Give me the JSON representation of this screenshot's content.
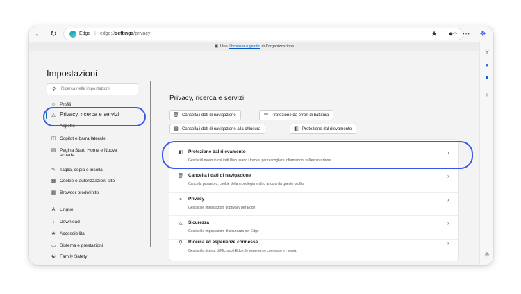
{
  "toolbar": {
    "back_icon": "arrow-left-icon",
    "refresh_icon": "refresh-icon",
    "site_label": "Edge",
    "url_prefix": "edge://",
    "url_bold": "settings",
    "url_suffix": "/privacy"
  },
  "banner": {
    "prefix": "Il tuo ",
    "link": "il browser è gestito",
    "suffix": " dall'organizzazione"
  },
  "nav": {
    "title": "Impostazioni",
    "search_placeholder": "Ricerca nelle impostazioni",
    "items": [
      {
        "label": "Profili",
        "icon": "profile-icon"
      },
      {
        "label": "Privacy, ricerca e servizi",
        "icon": "lock-icon"
      },
      {
        "label": "Aspetto",
        "icon": "appearance-icon"
      },
      {
        "label": "Copilot e barra laterale",
        "icon": "sidebar-icon"
      },
      {
        "label": "Pagina Start, Home e Nuova",
        "label2": "scheda",
        "icon": "home-icon"
      },
      {
        "label": "Taglia, copia e incolla",
        "icon": "clipboard-icon"
      },
      {
        "label": "Cookie e autorizzazioni sito",
        "icon": "cookie-icon"
      },
      {
        "label": "Browser predefinito",
        "icon": "browser-icon"
      },
      {
        "label": "Lingue",
        "icon": "language-icon"
      },
      {
        "label": "Download",
        "icon": "download-icon"
      },
      {
        "label": "Accessibilità",
        "icon": "accessibility-icon"
      },
      {
        "label": "Sistema e prestazioni",
        "icon": "system-icon"
      },
      {
        "label": "Family Safety",
        "icon": "family-icon"
      }
    ]
  },
  "main": {
    "title": "Privacy, ricerca e servizi",
    "chips": [
      {
        "label": "Cancella i dati di navigazione",
        "icon": "trash-icon"
      },
      {
        "label": "Protezione da errori di battitura",
        "icon": "typo-icon"
      },
      {
        "label": "Cancella i dati di navigazione alla chiusura",
        "icon": "clear-on-close-icon"
      },
      {
        "label": "Protezione dal rilevamento",
        "icon": "tracking-icon"
      }
    ],
    "rows": [
      {
        "title": "Protezione dal rilevamento",
        "desc": "Gestisci il modo in cui i siti Web usano i tracker per raccogliere informazioni sull'esplorazione",
        "icon": "tracking-icon"
      },
      {
        "title": "Cancella i dati di navigazione",
        "desc": "Cancella password, cookie della cronologia e altro ancora da questo profilo",
        "icon": "trash-icon"
      },
      {
        "title": "Privacy",
        "desc": "Gestisci le impostazioni di privacy per Edge",
        "icon": "privacy-icon"
      },
      {
        "title": "Sicurezza",
        "desc": "Gestisci le impostazioni di sicurezza per Edge",
        "icon": "security-icon"
      },
      {
        "title": "Ricerca ed esperienze connesse",
        "desc": "Gestisci la ricerca di Microsoft Edge, le esperienze connesse e i servizi",
        "icon": "search-icon"
      }
    ]
  },
  "colors": {
    "highlight": "#3b56e6",
    "accent": "#0f6cbd"
  }
}
